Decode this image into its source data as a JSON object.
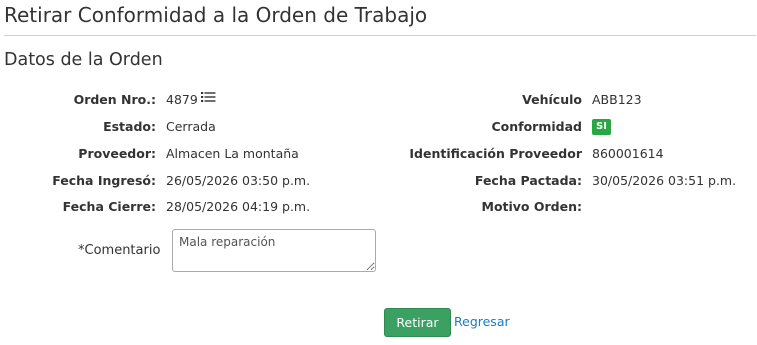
{
  "page": {
    "title": "Retirar Conformidad a la Orden de Trabajo",
    "section_title": "Datos de la Orden"
  },
  "order": {
    "left": [
      {
        "label": "Orden Nro.:",
        "value": "4879"
      },
      {
        "label": "Estado:",
        "value": "Cerrada"
      },
      {
        "label": "Proveedor:",
        "value": "Almacen La montaña"
      },
      {
        "label": "Fecha Ingresó:",
        "value": "26/05/2026 03:50 p.m."
      },
      {
        "label": "Fecha Cierre:",
        "value": "28/05/2026 04:19 p.m."
      }
    ],
    "right": [
      {
        "label": "Vehículo",
        "value": "ABB123"
      },
      {
        "label": "Conformidad",
        "value": "SI"
      },
      {
        "label": "Identificación Proveedor",
        "value": "860001614"
      },
      {
        "label": "Fecha Pactada:",
        "value": "30/05/2026 03:51 p.m."
      },
      {
        "label": "Motivo Orden:",
        "value": ""
      }
    ],
    "order_icon": "list-icon",
    "conformity_badge_color": "#28a745"
  },
  "form": {
    "comment_label": "*Comentario",
    "comment_value": "Mala reparación"
  },
  "actions": {
    "submit_label": "Retirar",
    "submit_color": "#3aa163",
    "back_label": "Regresar",
    "link_color": "#1a7cc1"
  }
}
